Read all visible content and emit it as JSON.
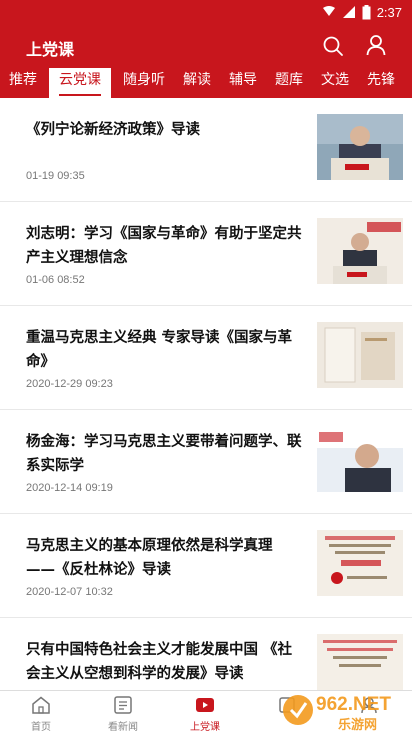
{
  "status": {
    "time": "2:37"
  },
  "app": {
    "title": "上党课",
    "search_icon": "search-icon",
    "user_icon": "user-icon"
  },
  "tabs": [
    {
      "label": "推荐",
      "active": false
    },
    {
      "label": "云党课",
      "active": true
    },
    {
      "label": "随身听",
      "active": false
    },
    {
      "label": "解读",
      "active": false
    },
    {
      "label": "辅导",
      "active": false
    },
    {
      "label": "题库",
      "active": false
    },
    {
      "label": "文选",
      "active": false
    },
    {
      "label": "先锋",
      "active": false
    }
  ],
  "articles": [
    {
      "title": "《列宁论新经济政策》导读",
      "date": "01-19 09:35"
    },
    {
      "title": "刘志明：学习《国家与革命》有助于坚定共产主义理想信念",
      "date": "01-06 08:52"
    },
    {
      "title": "重温马克思主义经典 专家导读《国家与革命》",
      "date": "2020-12-29 09:23"
    },
    {
      "title": "杨金海：学习马克思主义要带着问题学、联系实际学",
      "date": "2020-12-14 09:19"
    },
    {
      "title": "马克思主义的基本原理依然是科学真理 ——《反杜林论》导读",
      "date": "2020-12-07 10:32"
    },
    {
      "title": "只有中国特色社会主义才能发展中国 《社会主义从空想到科学的发展》导读",
      "date": ""
    }
  ],
  "bottom_nav": [
    {
      "label": "首页",
      "icon": "home-icon",
      "active": false
    },
    {
      "label": "看新闻",
      "icon": "news-icon",
      "active": false
    },
    {
      "label": "上党课",
      "icon": "play-icon",
      "active": true
    },
    {
      "label": "",
      "icon": "study-icon",
      "active": false
    },
    {
      "label": "",
      "icon": "me-icon",
      "active": false
    }
  ],
  "watermark": {
    "text": "962.NET",
    "subtext": "乐游网"
  },
  "colors": {
    "brand": "#c8161d",
    "text": "#111111",
    "muted": "#777777"
  }
}
